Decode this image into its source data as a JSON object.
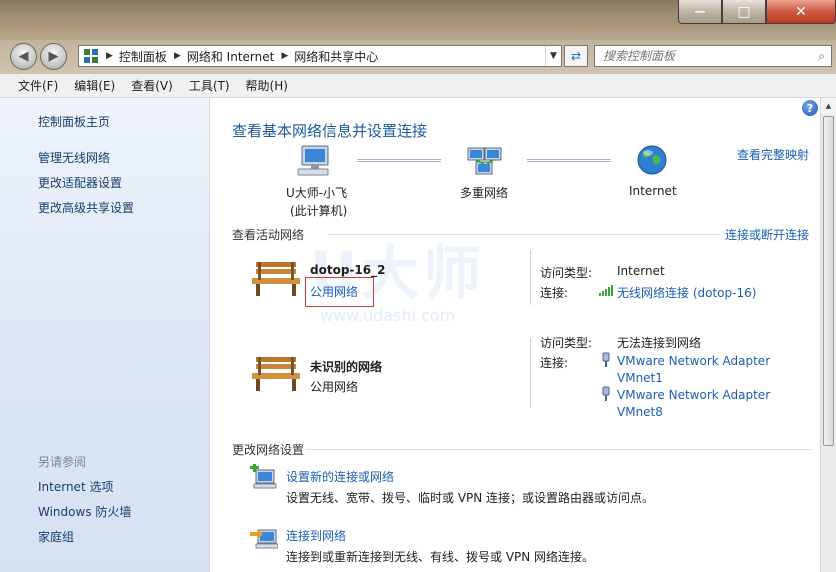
{
  "window": {
    "minimize_glyph": "—",
    "maximize_glyph": "□",
    "close_glyph": "✕"
  },
  "address": {
    "back_glyph": "◀",
    "forward_glyph": "▶",
    "segments": [
      "控制面板",
      "网络和 Internet",
      "网络和共享中心"
    ],
    "search_placeholder": "搜索控制面板"
  },
  "menu": [
    "文件(F)",
    "编辑(E)",
    "查看(V)",
    "工具(T)",
    "帮助(H)"
  ],
  "sidebar": {
    "home": "控制面板主页",
    "links": [
      "管理无线网络",
      "更改适配器设置",
      "更改高级共享设置"
    ],
    "see_also_title": "另请参阅",
    "see_also": [
      "Internet 选项",
      "Windows 防火墙",
      "家庭组"
    ]
  },
  "main": {
    "title": "查看基本网络信息并设置连接",
    "view_full_map": "查看完整映射",
    "map": {
      "computer_line1": "U大师-小飞",
      "computer_line2": "(此计算机)",
      "multi": "多重网络",
      "internet": "Internet"
    },
    "active_title": "查看活动网络",
    "connect_disconnect": "连接或断开连接",
    "networks": [
      {
        "name": "dotop-16_2",
        "type": "公用网络",
        "access_label": "访问类型:",
        "access_value": "Internet",
        "conn_label": "连接:",
        "conn_value": "无线网络连接 (dotop-16)"
      },
      {
        "name": "未识别的网络",
        "type": "公用网络",
        "access_label": "访问类型:",
        "access_value": "无法连接到网络",
        "conn_label": "连接:",
        "adapters": [
          {
            "line1": "VMware Network Adapter",
            "line2": "VMnet1"
          },
          {
            "line1": "VMware Network Adapter",
            "line2": "VMnet8"
          }
        ]
      }
    ],
    "change_title": "更改网络设置",
    "tasks": [
      {
        "title": "设置新的连接或网络",
        "desc": "设置无线、宽带、拨号、临时或 VPN 连接；或设置路由器或访问点。"
      },
      {
        "title": "连接到网络",
        "desc": "连接到或重新连接到无线、有线、拨号或 VPN 网络连接。"
      }
    ],
    "watermark": "U大师",
    "watermark_url": "www.udashi.com"
  },
  "colors": {
    "link": "#1a5fb4",
    "heading": "#1e5aa0",
    "highlight_box": "#d23a3a"
  }
}
